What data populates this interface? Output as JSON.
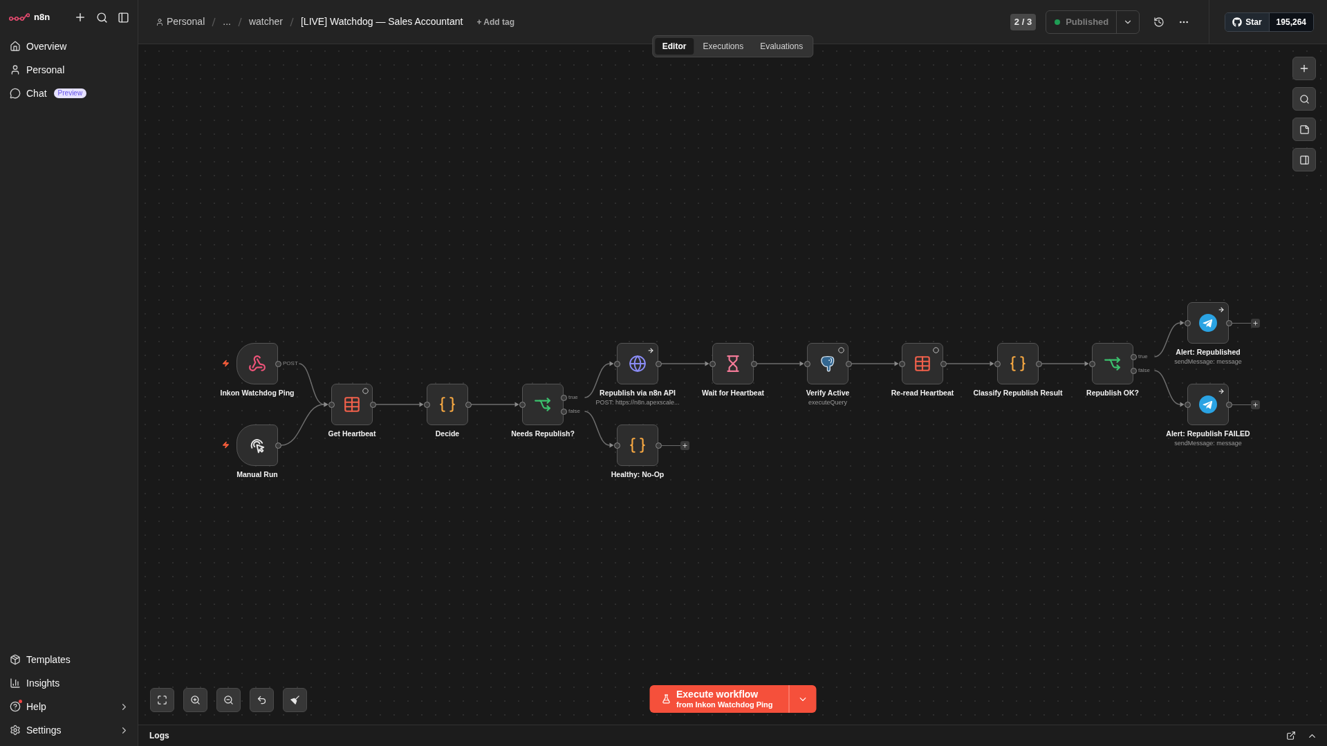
{
  "sidebar": {
    "app_name": "n8n",
    "items": [
      {
        "label": "Overview"
      },
      {
        "label": "Personal"
      },
      {
        "label": "Chat",
        "badge": "Preview"
      }
    ],
    "bottom_items": [
      {
        "label": "Templates",
        "has_submenu": false,
        "notification": false
      },
      {
        "label": "Insights",
        "has_submenu": false,
        "notification": false
      },
      {
        "label": "Help",
        "has_submenu": true,
        "notification": true
      },
      {
        "label": "Settings",
        "has_submenu": true,
        "notification": false
      }
    ]
  },
  "header": {
    "breadcrumb": [
      "Personal",
      "...",
      "watcher"
    ],
    "title": "[LIVE] Watchdog — Sales Accountant",
    "add_tag": "+ Add tag",
    "version": "2 / 3",
    "status": {
      "label": "Published",
      "active": true
    },
    "github": {
      "label": "Star",
      "count": "195,264"
    }
  },
  "tabs": [
    {
      "label": "Editor",
      "selected": true
    },
    {
      "label": "Executions",
      "selected": false
    },
    {
      "label": "Evaluations",
      "selected": false
    }
  ],
  "canvas": {
    "nodes": [
      {
        "name": "Inkon Watchdog Ping",
        "kind": "webhook",
        "trigger": true,
        "arrow_badge": false,
        "ring_badge": false,
        "outputs": [
          "POST"
        ]
      },
      {
        "name": "Manual Run",
        "kind": "manual",
        "trigger": true,
        "arrow_badge": false,
        "ring_badge": false
      },
      {
        "name": "Get Heartbeat",
        "kind": "datatable",
        "trigger": false,
        "arrow_badge": false,
        "ring_badge": true
      },
      {
        "name": "Decide",
        "kind": "code",
        "trigger": false,
        "arrow_badge": false,
        "ring_badge": false
      },
      {
        "name": "Needs Republish?",
        "kind": "if",
        "trigger": false,
        "arrow_badge": false,
        "ring_badge": false,
        "outputs": [
          "true",
          "false"
        ]
      },
      {
        "name": "Republish via n8n API",
        "kind": "http",
        "trigger": false,
        "arrow_badge": true,
        "ring_badge": false,
        "subtitle": "POST: https://n8n.apexscale..."
      },
      {
        "name": "Healthy: No-Op",
        "kind": "code",
        "trigger": false,
        "arrow_badge": false,
        "ring_badge": false
      },
      {
        "name": "Wait for Heartbeat",
        "kind": "wait",
        "trigger": false,
        "arrow_badge": false,
        "ring_badge": false
      },
      {
        "name": "Verify Active",
        "kind": "postgres",
        "trigger": false,
        "arrow_badge": false,
        "ring_badge": true,
        "subtitle": "executeQuery"
      },
      {
        "name": "Re-read Heartbeat",
        "kind": "datatable",
        "trigger": false,
        "arrow_badge": false,
        "ring_badge": true
      },
      {
        "name": "Classify Republish Result",
        "kind": "code",
        "trigger": false,
        "arrow_badge": false,
        "ring_badge": false
      },
      {
        "name": "Republish OK?",
        "kind": "if",
        "trigger": false,
        "arrow_badge": false,
        "ring_badge": false,
        "outputs": [
          "true",
          "false"
        ]
      },
      {
        "name": "Alert: Republished",
        "kind": "telegram",
        "trigger": false,
        "arrow_badge": true,
        "ring_badge": false,
        "subtitle": "sendMessage: message"
      },
      {
        "name": "Alert: Republish FAILED",
        "kind": "telegram",
        "trigger": false,
        "arrow_badge": true,
        "ring_badge": false,
        "subtitle": "sendMessage: message"
      }
    ]
  },
  "execute_button": {
    "label": "Execute workflow",
    "sublabel": "from Inkon Watchdog Ping"
  },
  "logs": {
    "label": "Logs"
  }
}
